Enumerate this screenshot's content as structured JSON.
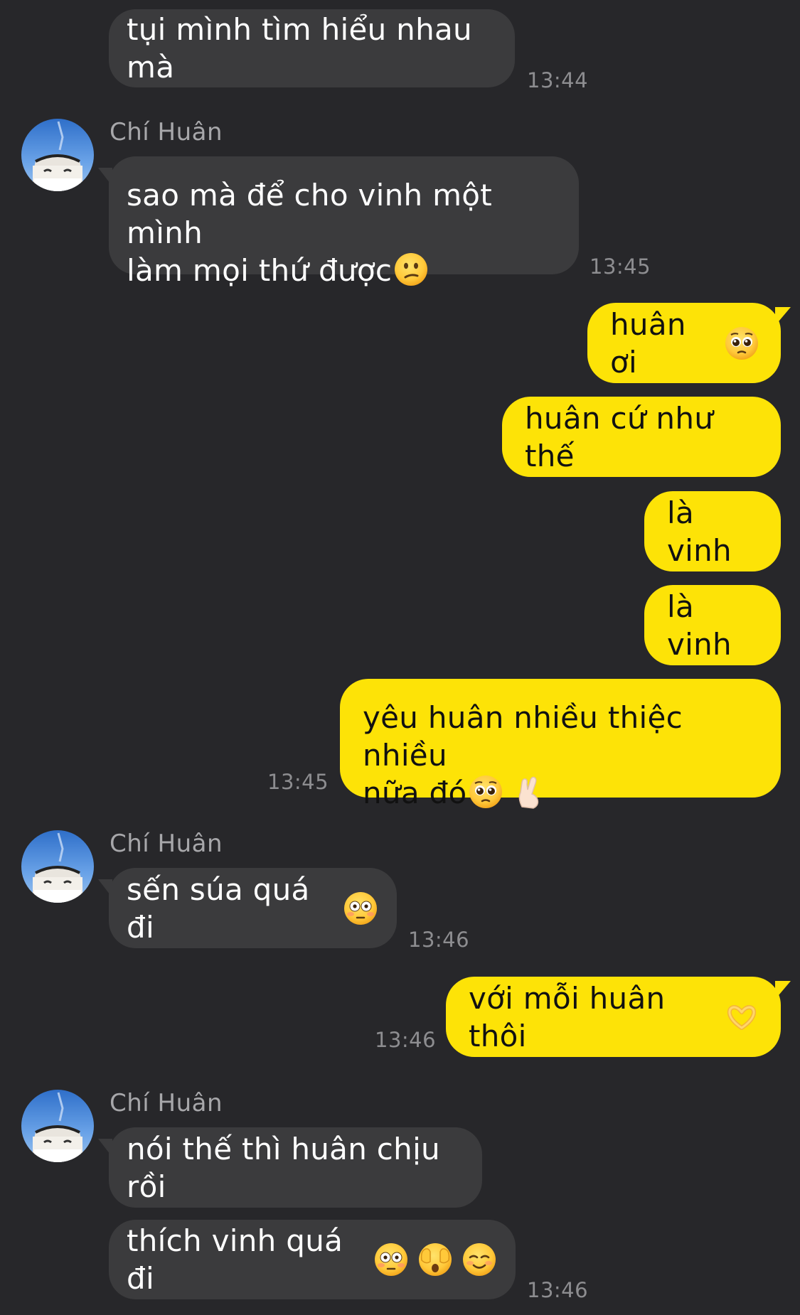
{
  "conversation": {
    "contact_name": "Chí Huân",
    "messages": [
      {
        "text": "tụi mình tìm hiểu nhau mà",
        "time": "13:44"
      },
      {
        "line1": "sao mà để cho vinh một mình",
        "line2": "làm mọi thứ được",
        "time": "13:45"
      },
      {
        "text": "huân ơi"
      },
      {
        "text": "huân cứ như thế"
      },
      {
        "text": "là vinh"
      },
      {
        "text": "là vinh"
      },
      {
        "line1": "yêu huân nhiều thiệc nhiều",
        "line2": "nữa đó",
        "time": "13:45"
      },
      {
        "text": "sến súa quá đi",
        "time": "13:46"
      },
      {
        "text": "với mỗi huân thôi",
        "time": "13:46"
      },
      {
        "text": "nói thế thì huân chịu rồi"
      },
      {
        "text": "thích vinh quá đi",
        "time": "13:46"
      }
    ]
  },
  "icons": {
    "m2": [
      "confused-face-emoji"
    ],
    "m3": [
      "pleading-face-emoji"
    ],
    "m7": [
      "pleading-face-emoji",
      "pinching-hand-emoji"
    ],
    "m8": [
      "flushed-face-emoji"
    ],
    "m9": [
      "heart-hands-emoji"
    ],
    "m11": [
      "flushed-face-emoji",
      "face-with-hand-over-eyes-emoji",
      "smiling-face-emoji"
    ]
  },
  "colors": {
    "background": "#27272a",
    "incoming_bubble": "#3b3b3d",
    "outgoing_bubble": "#fde307",
    "timestamp": "#8d8d90",
    "sender_name": "#a7a7aa"
  }
}
